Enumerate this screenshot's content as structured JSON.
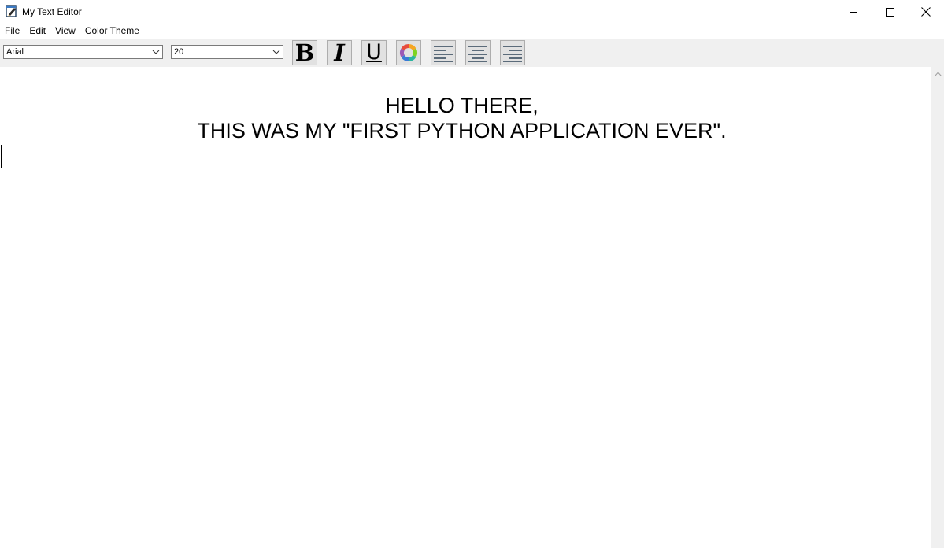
{
  "window": {
    "title": "My Text Editor",
    "icon": "notepad-pen-icon"
  },
  "window_controls": {
    "minimize_icon": "minimize-icon",
    "maximize_icon": "maximize-icon",
    "close_icon": "close-icon"
  },
  "menu": {
    "items": [
      "File",
      "Edit",
      "View",
      "Color Theme"
    ]
  },
  "toolbar": {
    "font_family": {
      "value": "Arial",
      "icon": "chevron-down-icon"
    },
    "font_size": {
      "value": "20",
      "icon": "chevron-down-icon"
    },
    "bold_label": "B",
    "italic_label": "I",
    "underline_label": "U",
    "color_icon": "color-wheel-icon",
    "align_left_icon": "align-left-icon",
    "align_center_icon": "align-center-icon",
    "align_right_icon": "align-right-icon"
  },
  "editor": {
    "lines": [
      "HELLO THERE,",
      "THIS WAS MY \"FIRST PYTHON APPLICATION EVER\"."
    ],
    "text_color": "#000000",
    "background": "#ffffff"
  }
}
